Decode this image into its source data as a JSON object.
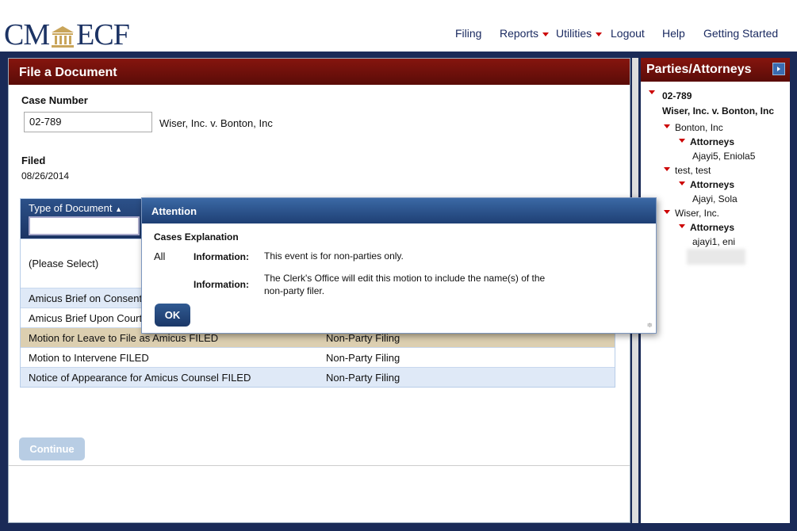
{
  "app": {
    "logo": "CM/ECF",
    "logo_left": "CM",
    "logo_right": "ECF"
  },
  "nav": [
    {
      "label": "Filing"
    },
    {
      "label": "Reports",
      "dropdown": true
    },
    {
      "label": "Utilities",
      "dropdown": true
    },
    {
      "label": "Logout"
    },
    {
      "label": "Help"
    },
    {
      "label": "Getting Started"
    }
  ],
  "main": {
    "title": "File a Document",
    "case_number_label": "Case Number",
    "case_number_value": "02-789",
    "case_name": "Wiser, Inc. v. Bonton, Inc",
    "filed_label": "Filed",
    "filed_value": "08/26/2014",
    "table": {
      "header": "Type of Document",
      "sort": "ascending",
      "filter_value": "",
      "rows": [
        {
          "doc": "(Please Select)",
          "type": ""
        },
        {
          "doc": "Amicus Brief on Consent",
          "type": ""
        },
        {
          "doc": "Amicus Brief Upon Court",
          "type": ""
        },
        {
          "doc": "Motion for Leave to File as Amicus FILED",
          "type": "Non-Party Filing"
        },
        {
          "doc": "Motion to Intervene FILED",
          "type": "Non-Party Filing"
        },
        {
          "doc": "Notice of Appearance for Amicus Counsel FILED",
          "type": "Non-Party Filing"
        }
      ]
    },
    "continue_label": "Continue"
  },
  "dialog": {
    "title": "Attention",
    "heading": "Cases Explanation",
    "scope": "All",
    "info_label": "Information:",
    "info1": "This event is for non-parties only.",
    "info2_line1": "The Clerk's Office will edit this motion to include the name(s) of the",
    "info2_line2": "non-party filer.",
    "ok_label": "OK"
  },
  "parties": {
    "title": "Parties/Attorneys",
    "case": "02-789",
    "case_name": "Wiser, Inc. v. Bonton, Inc",
    "attorneys_label": "Attorneys",
    "list": [
      {
        "party": "Bonton, Inc",
        "attorney": "Ajayi5, Eniola5"
      },
      {
        "party": "test, test",
        "attorney": "Ajayi, Sola"
      },
      {
        "party": "Wiser, Inc.",
        "attorney": "ajayi1, eni"
      }
    ]
  },
  "colors": {
    "navy": "#1a2a57",
    "maroon": "#7a120c",
    "selected_row": "#dccfb0",
    "alt_row": "#dfe9f7"
  }
}
